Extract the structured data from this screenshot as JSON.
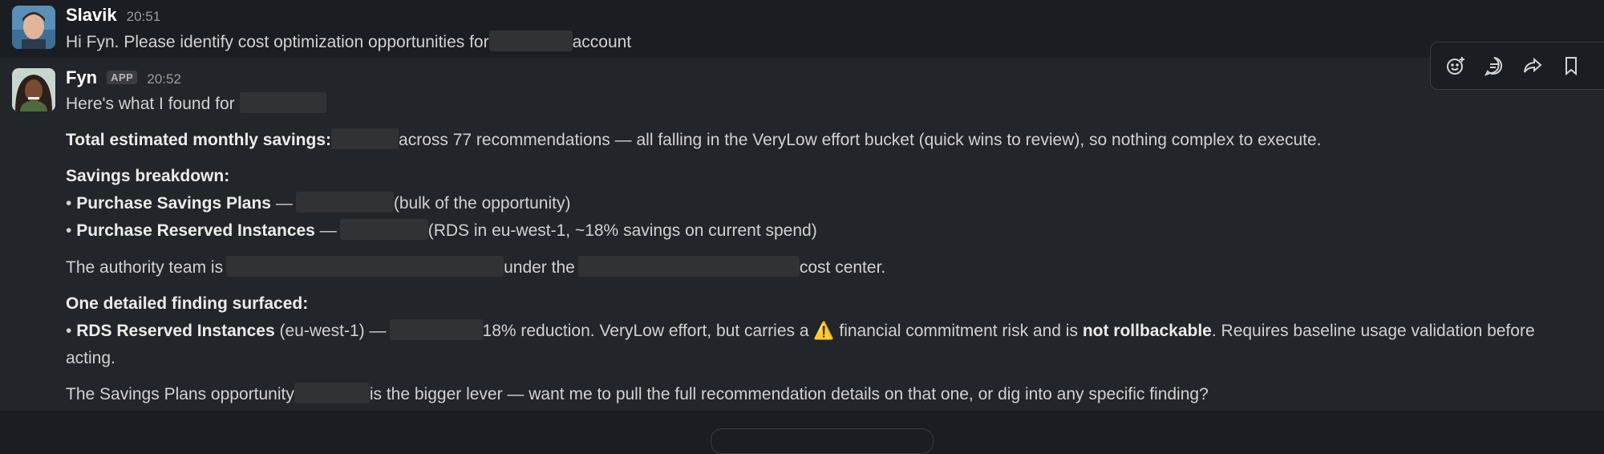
{
  "messages": {
    "m1": {
      "author": "Slavik",
      "time": "20:51",
      "text_a": "Hi Fyn. Please identify cost optimization opportunities for",
      "text_b": "account"
    },
    "m2": {
      "author": "Fyn",
      "badge": "APP",
      "time": "20:52",
      "intro": "Here's what I found for",
      "total_label": "Total estimated monthly savings:",
      "total_rest": "across 77 recommendations — all falling in the VeryLow effort bucket (quick wins to review), so nothing complex to execute.",
      "breakdown_heading": "Savings breakdown:",
      "bullet1_label": "Purchase Savings Plans",
      "bullet1_dash": " —",
      "bullet1_rest": "(bulk of the opportunity)",
      "bullet2_label": "Purchase Reserved Instances",
      "bullet2_dash": " —",
      "bullet2_rest": "(RDS in eu-west-1, ~18% savings on current spend)",
      "authority_a": "The authority team is",
      "authority_b": "under the",
      "authority_c": "cost center.",
      "finding_heading": "One detailed finding surfaced:",
      "finding_label": "RDS Reserved Instances",
      "finding_region": " (eu-west-1) —",
      "finding_rest_a": "18% reduction. VeryLow effort, but carries a",
      "finding_rest_b": "financial commitment risk and is",
      "finding_bold": "not rollbackable",
      "finding_rest_c": ". Requires baseline usage validation before",
      "finding_cont": "acting.",
      "closing_a": "The Savings Plans opportunity",
      "closing_b": "is the bigger lever — want me to pull the full recommendation details on that one, or dig into any specific finding?",
      "bullet_char": "•",
      "warning_glyph": "⚠️"
    }
  },
  "actions": [
    "add-reaction-icon",
    "reply-in-thread-icon",
    "share-icon",
    "save-bookmark-icon"
  ],
  "colors": {
    "background": "#1a1d21",
    "hover_background": "#222529",
    "text": "#d1d2d3",
    "redaction": "#303236"
  }
}
